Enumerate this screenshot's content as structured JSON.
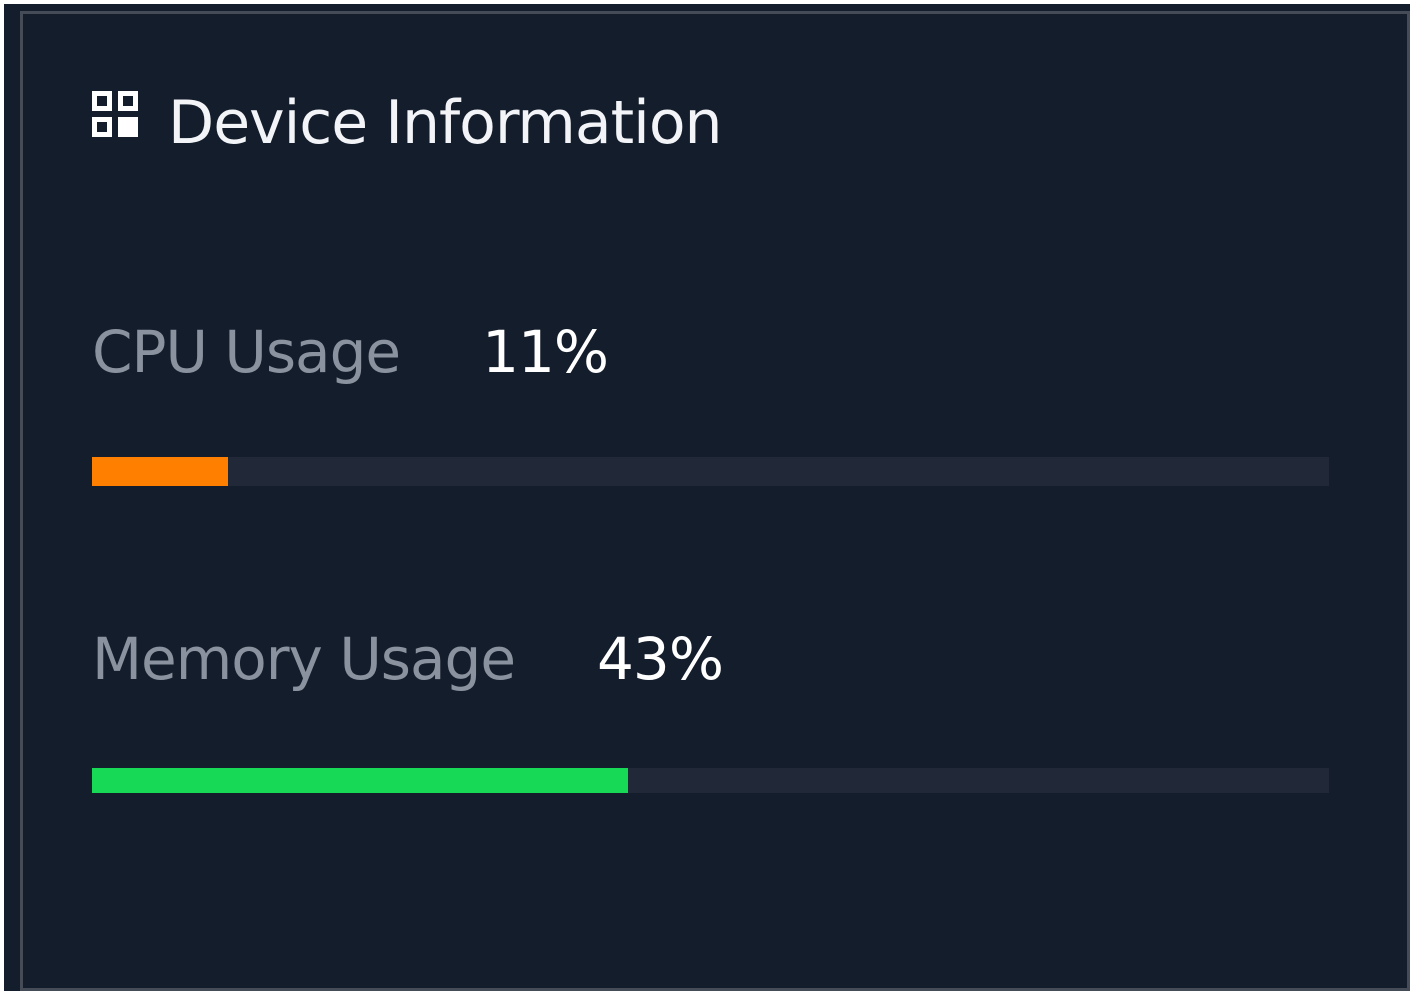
{
  "panel": {
    "title": "Device Information",
    "icon": "grid-icon"
  },
  "metrics": [
    {
      "label": "CPU Usage",
      "value_text": "11%",
      "value": 11,
      "color": "#ff7f00"
    },
    {
      "label": "Memory Usage",
      "value_text": "43%",
      "value": 43.3,
      "color": "#17d955"
    }
  ],
  "colors": {
    "background": "#141d2b",
    "border": "#454b57",
    "track": "#212938",
    "label": "#8a929f",
    "value": "#ffffff"
  }
}
